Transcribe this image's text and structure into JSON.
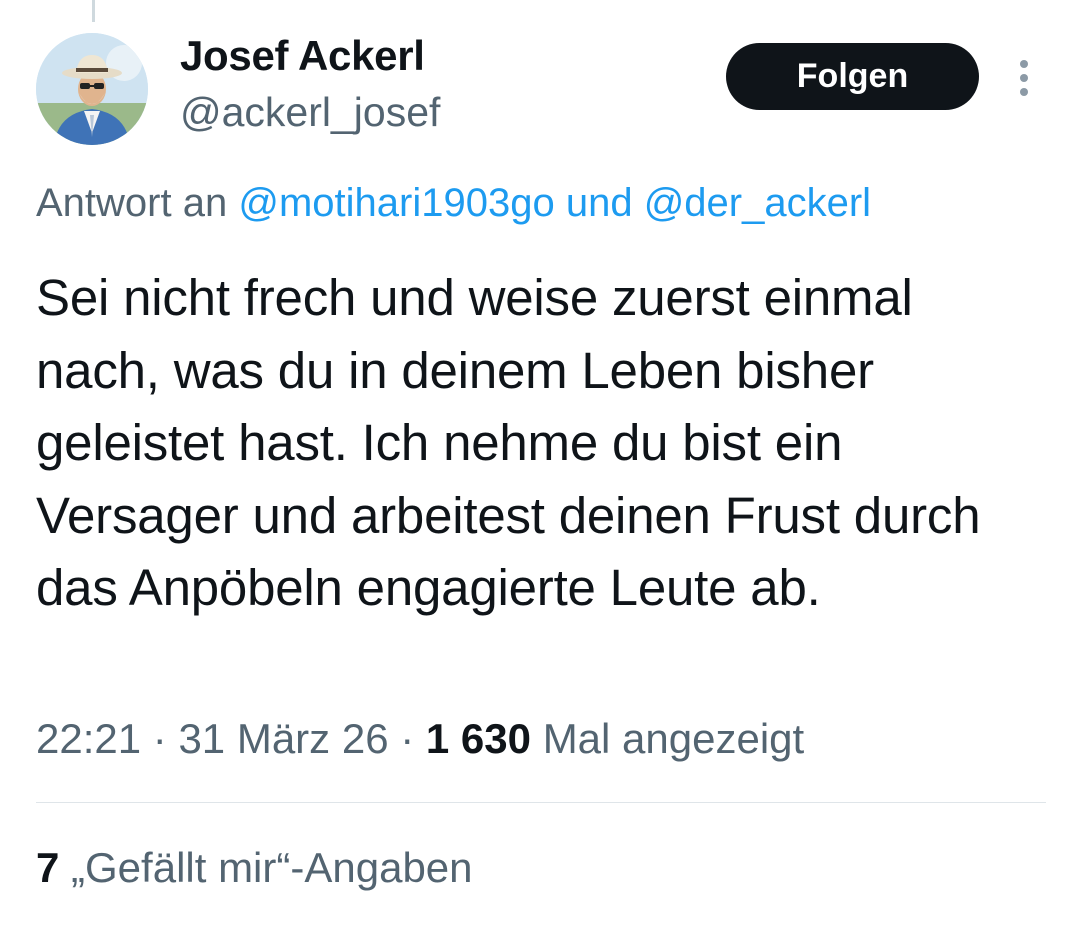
{
  "author": {
    "display_name": "Josef Ackerl",
    "handle": "@ackerl_josef",
    "avatar_icon": "profile-photo"
  },
  "header": {
    "follow_label": "Folgen",
    "more_icon": "vertical-ellipsis-icon"
  },
  "reply": {
    "prefix": "Antwort an",
    "mention_1": "@motihari1903go",
    "conjunction": "und",
    "mention_2": "@der_ackerl"
  },
  "tweet": {
    "text": "Sei nicht frech und weise zuerst einmal nach, was du in deinem Leben bisher geleistet hast. Ich nehme du bist ein Versager und arbeitest deinen Frust durch das Anpöbeln engagierte Leute ab."
  },
  "meta": {
    "time": "22:21",
    "separator": "·",
    "date": "31 März 26",
    "views_count": "1 630",
    "views_label": "Mal angezeigt"
  },
  "stats": {
    "likes_count": "7",
    "likes_label": "„Gefällt mir“-Angaben"
  },
  "colors": {
    "text": "#0f1419",
    "secondary": "#536471",
    "link": "#1d9bf0",
    "button_bg": "#0f1419",
    "divider": "#dfe5e9"
  }
}
